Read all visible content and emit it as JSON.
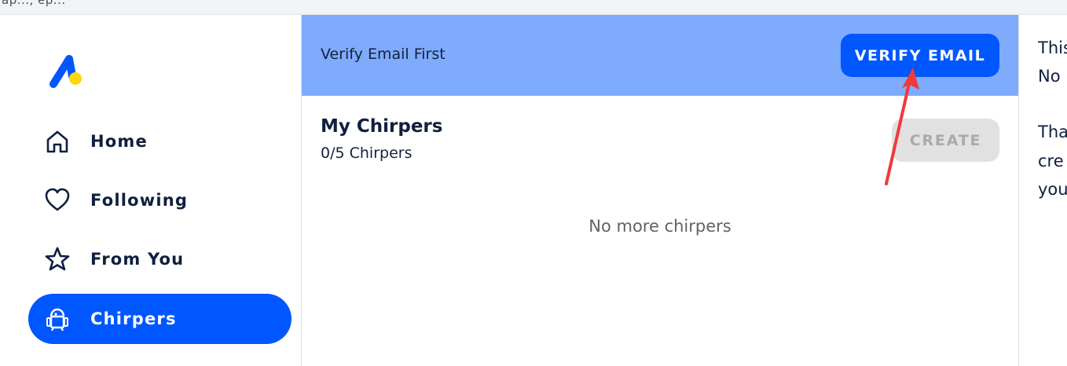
{
  "topbar": {
    "text": "ap...,  ep..."
  },
  "sidebar": {
    "items": [
      {
        "label": "Home",
        "icon": "home-icon",
        "active": false
      },
      {
        "label": "Following",
        "icon": "heart-icon",
        "active": false
      },
      {
        "label": "From You",
        "icon": "star-icon",
        "active": false
      },
      {
        "label": "Chirpers",
        "icon": "robot-icon",
        "active": true
      }
    ]
  },
  "banner": {
    "text": "Verify Email First",
    "button_label": "VERIFY EMAIL"
  },
  "main": {
    "title": "My Chirpers",
    "count": "0/5 Chirpers",
    "create_label": "CREATE",
    "empty_message": "No more chirpers"
  },
  "right_panel": {
    "lines": [
      "This",
      "No",
      "Tha",
      "cre",
      "you"
    ]
  },
  "colors": {
    "accent": "#0057ff",
    "banner_bg": "#7eabfc",
    "logo_yellow": "#ffd60a",
    "annotation_arrow": "#f03a3a"
  }
}
